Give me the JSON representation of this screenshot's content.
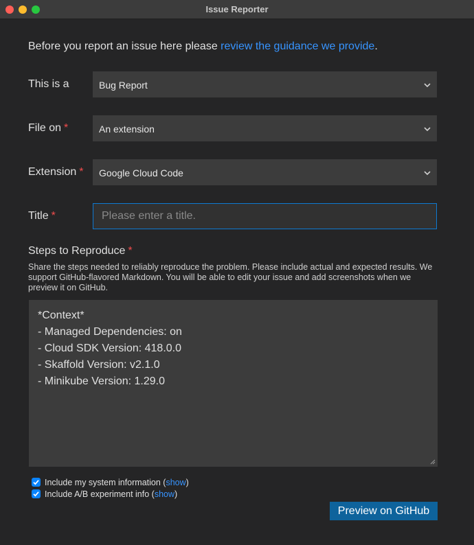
{
  "window": {
    "title": "Issue Reporter"
  },
  "intro": {
    "text_before": "Before you report an issue here please ",
    "link_text": "review the guidance we provide",
    "text_after": "."
  },
  "form": {
    "issue_type": {
      "label": "This is a",
      "value": "Bug Report"
    },
    "file_on": {
      "label": "File on",
      "required": "*",
      "value": "An extension"
    },
    "extension": {
      "label": "Extension",
      "required": "*",
      "value": "Google Cloud Code"
    },
    "title": {
      "label": "Title",
      "required": "*",
      "value": "",
      "placeholder": "Please enter a title."
    },
    "steps": {
      "label": "Steps to Reproduce",
      "required": "*",
      "help": "Share the steps needed to reliably reproduce the problem. Please include actual and expected results. We support GitHub-flavored Markdown. You will be able to edit your issue and add screenshots when we preview it on GitHub.",
      "lines": [
        "*Context*",
        "- Managed Dependencies: on",
        "- Cloud SDK Version: 418.0.0",
        "- Skaffold Version: v2.1.0",
        "- Minikube Version: 1.29.0"
      ]
    }
  },
  "options": {
    "system_info": {
      "label": "Include my system information (",
      "link": "show",
      "suffix": ")",
      "checked": true
    },
    "experiment_info": {
      "label": "Include A/B experiment info (",
      "link": "show",
      "suffix": ")",
      "checked": true
    }
  },
  "actions": {
    "preview_label": "Preview on GitHub"
  },
  "colors": {
    "accent": "#3794ff",
    "button": "#0e639c",
    "required": "#f14c4c",
    "focus_border": "#0e7ad3"
  }
}
